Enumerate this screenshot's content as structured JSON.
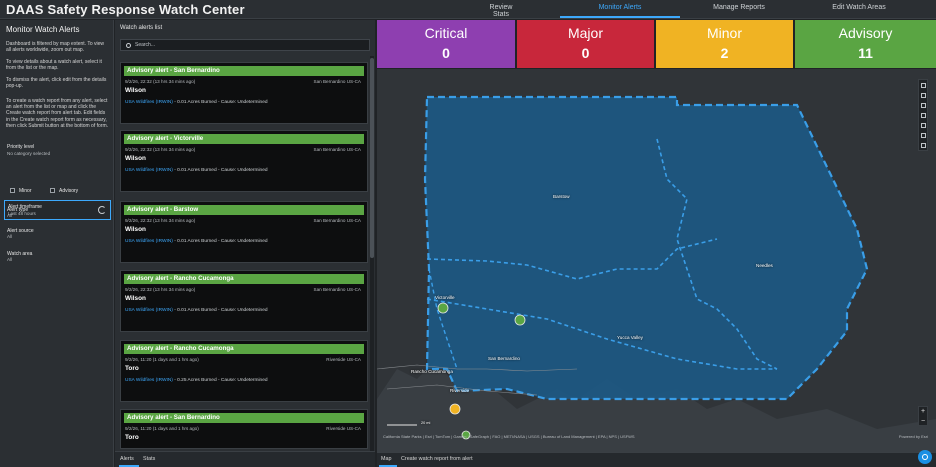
{
  "header": {
    "title": "DAAS Safety Response Watch Center",
    "tabs": [
      {
        "label": "Review Stats",
        "active": false
      },
      {
        "label": "Monitor Alerts",
        "active": true
      },
      {
        "label": "Manage Reports",
        "active": false
      },
      {
        "label": "Edit Watch Areas",
        "active": false
      }
    ]
  },
  "left_panel": {
    "title": "Monitor Watch Alerts",
    "desc1": "Dashboard is filtered by map extent. To view all alerts worldwide, zoom out map.",
    "desc2": "To view details about a watch alert, select it from the list or the map.",
    "desc3": "To dismiss the alert, click edit from the details pop-up.",
    "desc4": "To create a watch report from any alert, select an alert from the list or map and click the Create watch report from alert tab. Edit fields in the Create watch report form as necessary, then click Submit button at the bottom of form.",
    "priority_label": "Priority level",
    "priority_sub": "No category selected",
    "check_minor": "Minor",
    "check_advisory": "Advisory",
    "timeframe_label": "Alert timeframe",
    "timeframe_value": "Last 48 hours",
    "type_label": "Alert type",
    "type_value": "All",
    "source_label": "Alert source",
    "source_value": "All",
    "watch_label": "Watch area",
    "watch_value": "All"
  },
  "alerts_list": {
    "title": "Watch alerts list",
    "search_placeholder": "Search...",
    "items": [
      {
        "heading": "Advisory alert - San Bernardino",
        "time": "9/2/26, 22:32 (13 hrs 34 mins ago)",
        "location": "San Bernardino US-CA",
        "name": "Wilson",
        "source": "USA Wildfires (IRWIN)",
        "detail": " - 0.01 Acres Burned - Cause: Undetermined"
      },
      {
        "heading": "Advisory alert - Victorville",
        "time": "9/2/26, 22:32 (13 hrs 34 mins ago)",
        "location": "San Bernardino US-CA",
        "name": "Wilson",
        "source": "USA Wildfires (IRWIN)",
        "detail": " - 0.01 Acres Burned - Cause: Undetermined"
      },
      {
        "heading": "Advisory alert - Barstow",
        "time": "9/2/26, 22:32 (13 hrs 34 mins ago)",
        "location": "San Bernardino US-CA",
        "name": "Wilson",
        "source": "USA Wildfires (IRWIN)",
        "detail": " - 0.01 Acres Burned - Cause: Undetermined"
      },
      {
        "heading": "Advisory alert - Rancho Cucamonga",
        "time": "9/2/26, 22:32 (13 hrs 34 mins ago)",
        "location": "San Bernardino US-CA",
        "name": "Wilson",
        "source": "USA Wildfires (IRWIN)",
        "detail": " - 0.01 Acres Burned - Cause: Undetermined"
      },
      {
        "heading": "Advisory alert - Rancho Cucamonga",
        "time": "9/2/26, 11:20 (1 days and 1 hrs ago)",
        "location": "Riverside US-CA",
        "name": "Toro",
        "source": "USA Wildfires (IRWIN)",
        "detail": " - 0.25 Acres Burned - Cause: Undetermined"
      },
      {
        "heading": "Advisory alert - San Bernardino",
        "time": "9/2/26, 11:20 (1 days and 1 hrs ago)",
        "location": "Riverside US-CA",
        "name": "Toro",
        "source": "",
        "detail": ""
      }
    ],
    "tab_alerts": "Alerts",
    "tab_stats": "Stats"
  },
  "stats": [
    {
      "label": "Critical",
      "value": "0",
      "color": "#8e3fb0"
    },
    {
      "label": "Major",
      "value": "0",
      "color": "#c8273b"
    },
    {
      "label": "Minor",
      "value": "2",
      "color": "#f0b323"
    },
    {
      "label": "Advisory",
      "value": "11",
      "color": "#5aa543"
    }
  ],
  "map": {
    "labels": {
      "barstow": "Barstow",
      "needles": "Needles",
      "victorville": "Victorville",
      "yucca": "Yucca Valley",
      "sanbern": "San Bernardino",
      "rancho": "Rancho Cucamonga",
      "riverside": "Riverside"
    },
    "scale_mi": "20 mi",
    "attribution": "California State Parks | Esri | TomTom | Garmin | SafeGraph | FAO | METI/NASA | USGS | Bureau of Land Management | EPA | NPS | USFWS",
    "powered": "Powered by Esri",
    "tab_map": "Map",
    "tab_create": "Create watch report from alert"
  },
  "colors": {
    "accent": "#3da9fc",
    "advisory": "#5aa543",
    "region_fill": "#1b5a86",
    "region_stroke": "#3a9ee8"
  }
}
